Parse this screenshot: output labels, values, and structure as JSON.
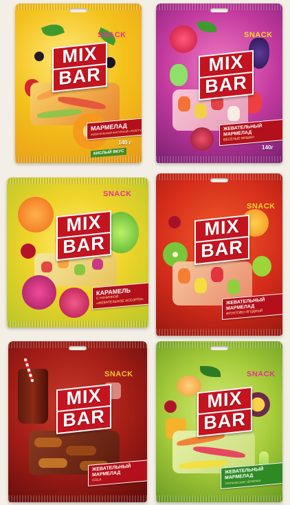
{
  "products": [
    {
      "logo_top": "MIX",
      "logo_bottom": "BAR",
      "snack": "SNACK",
      "label_title": "МАРМЕЛАД",
      "label_sub": "ЖЕВАТЕЛЬНЫЙ ФИГУРНЫЙ «ТОЛСТУШКИ-ЗМЕЮШКИ»",
      "tag": "КИСЛЫЙ ВКУС",
      "weight": "140 г"
    },
    {
      "logo_top": "MIX",
      "logo_bottom": "BAR",
      "snack": "SNACK",
      "label_title": "ЖЕВАТЕЛЬНЫЙ МАРМЕЛАД",
      "label_sub": "ВЕСЁЛЫЕ МИШКИ",
      "weight": "140г"
    },
    {
      "logo_top": "MIX",
      "logo_bottom": "BAR",
      "snack": "SNACK",
      "label_title": "КАРАМЕЛЬ",
      "label_sub": "С НАЧИНКОЙ «ЖЕВАТЕЛЬНОЕ АССОРТИ»"
    },
    {
      "logo_top": "MIX",
      "logo_bottom": "BAR",
      "snack": "SNACK",
      "label_title": "ЖЕВАТЕЛЬНЫЙ МАРМЕЛАД",
      "label_sub": "ФРУКТОВО-ЯГОДНЫЙ"
    },
    {
      "logo_top": "MIX",
      "logo_bottom": "BAR",
      "snack": "SNACK",
      "label_title": "ЖЕВАТЕЛЬНЫЙ МАРМЕЛАД",
      "label_sub": "COLA"
    },
    {
      "logo_top": "MIX",
      "logo_bottom": "BAR",
      "snack": "SNACK",
      "label_title": "ЖЕВАТЕЛЬНЫЙ МАРМЕЛАД",
      "label_sub": "ТРОПИЧЕСКИЕ ЧЕРВЯЧКИ"
    }
  ],
  "colors": {
    "brand_red": "#c41420",
    "pack1": "#f2c21a",
    "pack2": "#b3339a",
    "pack3": "#f2d22a",
    "pack4": "#d9351f",
    "pack5": "#8f1a16",
    "pack6": "#9ec63a"
  }
}
